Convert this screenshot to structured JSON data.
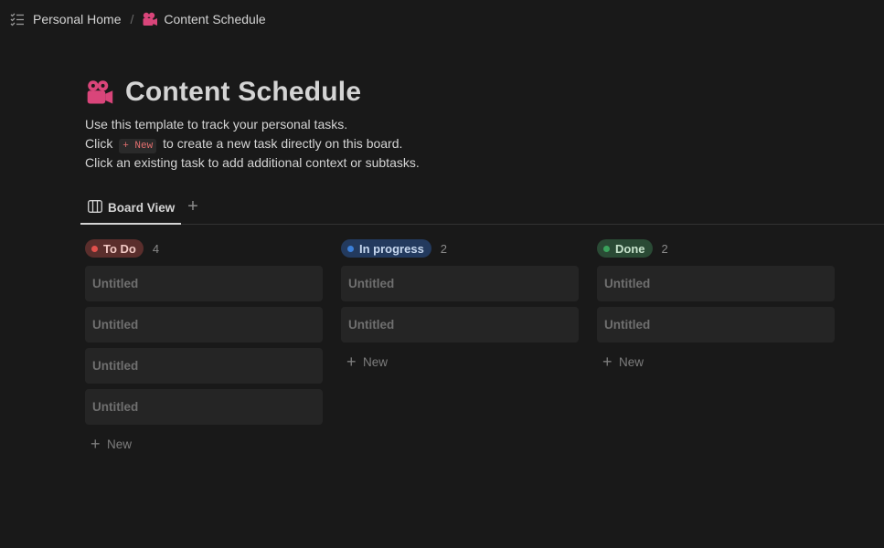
{
  "breadcrumb": {
    "home_label": "Personal Home",
    "separator": "/",
    "page_label": "Content Schedule"
  },
  "page": {
    "title": "Content Schedule",
    "desc_line1": "Use this template to track your personal tasks.",
    "desc_line2_pre": "Click",
    "desc_line2_code": "+ New",
    "desc_line2_post": "to create a new task directly on this board.",
    "desc_line3": "Click an existing task to add additional context or subtasks."
  },
  "tabs": {
    "active_label": "Board View",
    "add_label": "+"
  },
  "colors": {
    "accent_pink": "#d9457a",
    "todo_bg": "#5a2e2c",
    "todo_text": "#f2c9c4",
    "todo_dot": "#e0504c",
    "progress_bg": "#233a5e",
    "progress_text": "#c8d9f0",
    "progress_dot": "#3b7fd8",
    "done_bg": "#2a4a35",
    "done_text": "#c7e3cc",
    "done_dot": "#3aa35c"
  },
  "board": {
    "columns": [
      {
        "label": "To Do",
        "count": "4",
        "cards": [
          "Untitled",
          "Untitled",
          "Untitled",
          "Untitled"
        ],
        "new_label": "New"
      },
      {
        "label": "In progress",
        "count": "2",
        "cards": [
          "Untitled",
          "Untitled"
        ],
        "new_label": "New"
      },
      {
        "label": "Done",
        "count": "2",
        "cards": [
          "Untitled",
          "Untitled"
        ],
        "new_label": "New"
      }
    ]
  }
}
